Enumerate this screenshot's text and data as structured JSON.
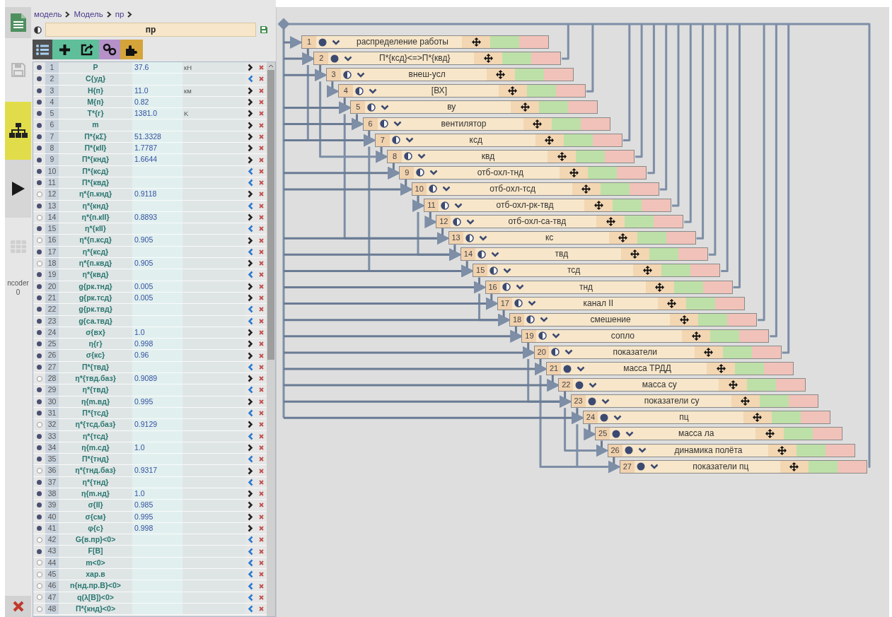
{
  "sidebar": {
    "items": [
      {
        "kind": "document",
        "selected": false
      },
      {
        "kind": "save",
        "selected": false
      },
      {
        "kind": "diagram",
        "selected": true
      },
      {
        "kind": "run",
        "selected": false
      },
      {
        "kind": "table",
        "selected": false
      }
    ],
    "label": "ncoder",
    "count": "0"
  },
  "breadcrumb": [
    {
      "label": "модель"
    },
    {
      "label": "Модель"
    },
    {
      "label": "пр"
    }
  ],
  "title_field": {
    "value": "пр"
  },
  "rows": [
    {
      "n": "1",
      "name": "P",
      "value": "37.6",
      "unit": "кН",
      "filled": true,
      "kind": "output"
    },
    {
      "n": "2",
      "name": "C{уд}",
      "filled": true,
      "kind": "input"
    },
    {
      "n": "3",
      "name": "H{п}",
      "value": "11.0",
      "unit": "км",
      "filled": true,
      "kind": "output"
    },
    {
      "n": "4",
      "name": "M{п}",
      "value": "0.82",
      "filled": true,
      "kind": "output"
    },
    {
      "n": "5",
      "name": "T*{г}",
      "value": "1381.0",
      "unit": "K",
      "filled": true,
      "kind": "output"
    },
    {
      "n": "6",
      "name": "m",
      "filled": true,
      "kind": "output"
    },
    {
      "n": "7",
      "name": "П*{кΣ}",
      "value": "51.3328",
      "filled": true,
      "kind": "output"
    },
    {
      "n": "8",
      "name": "П*{кII}",
      "value": "1.7787",
      "filled": true,
      "kind": "output"
    },
    {
      "n": "9",
      "name": "П*{кнд}",
      "value": "1.6644",
      "filled": true,
      "kind": "output"
    },
    {
      "n": "10",
      "name": "П*{ксд}",
      "filled": true,
      "kind": "input"
    },
    {
      "n": "11",
      "name": "П*{квд}",
      "filled": true,
      "kind": "input"
    },
    {
      "n": "12",
      "name": "η*{п.кнд}",
      "value": "0.9118",
      "filled": false,
      "kind": "output"
    },
    {
      "n": "13",
      "name": "η*{кнд}",
      "filled": true,
      "kind": "input"
    },
    {
      "n": "14",
      "name": "η*{п.кII}",
      "value": "0.8893",
      "filled": false,
      "kind": "output"
    },
    {
      "n": "15",
      "name": "η*{кII}",
      "filled": true,
      "kind": "input"
    },
    {
      "n": "16",
      "name": "η*{п.ксд}",
      "value": "0.905",
      "filled": false,
      "kind": "output"
    },
    {
      "n": "17",
      "name": "η*{ксд}",
      "filled": true,
      "kind": "input"
    },
    {
      "n": "18",
      "name": "η*{п.квд}",
      "value": "0.905",
      "filled": false,
      "kind": "output"
    },
    {
      "n": "19",
      "name": "η*{квд}",
      "filled": true,
      "kind": "input"
    },
    {
      "n": "20",
      "name": "g{рк.тнд}",
      "value": "0.005",
      "filled": true,
      "kind": "output"
    },
    {
      "n": "21",
      "name": "g{рк.тсд}",
      "value": "0.005",
      "filled": true,
      "kind": "output"
    },
    {
      "n": "22",
      "name": "g{рк.твд}",
      "filled": true,
      "kind": "input"
    },
    {
      "n": "23",
      "name": "g{са.твд}",
      "filled": true,
      "kind": "input"
    },
    {
      "n": "24",
      "name": "σ{вх}",
      "value": "1.0",
      "filled": true,
      "kind": "output"
    },
    {
      "n": "25",
      "name": "η{г}",
      "value": "0.998",
      "filled": true,
      "kind": "output"
    },
    {
      "n": "26",
      "name": "σ{кс}",
      "value": "0.96",
      "filled": true,
      "kind": "output"
    },
    {
      "n": "27",
      "name": "П*{твд}",
      "filled": true,
      "kind": "input"
    },
    {
      "n": "28",
      "name": "η*{твд.баз}",
      "value": "0.9089",
      "filled": false,
      "kind": "output"
    },
    {
      "n": "29",
      "name": "η*{твд}",
      "filled": true,
      "kind": "input"
    },
    {
      "n": "30",
      "name": "η{m.вд}",
      "value": "0.995",
      "filled": true,
      "kind": "output"
    },
    {
      "n": "31",
      "name": "П*{тсд}",
      "filled": true,
      "kind": "input"
    },
    {
      "n": "32",
      "name": "η*{тсд.баз}",
      "value": "0.9129",
      "filled": false,
      "kind": "output"
    },
    {
      "n": "33",
      "name": "η*{тсд}",
      "filled": true,
      "kind": "input"
    },
    {
      "n": "34",
      "name": "η{m.сд}",
      "value": "1.0",
      "filled": true,
      "kind": "output"
    },
    {
      "n": "35",
      "name": "П*{тнд}",
      "filled": true,
      "kind": "input"
    },
    {
      "n": "36",
      "name": "η*{тнд.баз}",
      "value": "0.9317",
      "filled": false,
      "kind": "output"
    },
    {
      "n": "37",
      "name": "η*{тнд}",
      "filled": true,
      "kind": "input"
    },
    {
      "n": "38",
      "name": "η{m.нд}",
      "value": "1.0",
      "filled": true,
      "kind": "output"
    },
    {
      "n": "39",
      "name": "σ{II}",
      "value": "0.985",
      "filled": true,
      "kind": "output"
    },
    {
      "n": "40",
      "name": "σ{см}",
      "value": "0.995",
      "filled": true,
      "kind": "output"
    },
    {
      "n": "41",
      "name": "φ{c}",
      "value": "0.998",
      "filled": true,
      "kind": "output"
    },
    {
      "n": "42",
      "name": "G{в.пр}<0>",
      "filled": false,
      "kind": "input"
    },
    {
      "n": "43",
      "name": "F[B]",
      "filled": true,
      "kind": "input"
    },
    {
      "n": "44",
      "name": "m<0>",
      "filled": false,
      "kind": "input"
    },
    {
      "n": "45",
      "name": "хар.в",
      "filled": false,
      "kind": "input"
    },
    {
      "n": "46",
      "name": "n{нд.пр.В}<0>",
      "filled": false,
      "kind": "input"
    },
    {
      "n": "47",
      "name": "q(λ[B])<0>",
      "filled": false,
      "kind": "input"
    },
    {
      "n": "48",
      "name": "П*{кнд}<0>",
      "filled": false,
      "kind": "input"
    }
  ],
  "nodes": [
    {
      "n": "1",
      "label": "распределение работы",
      "kind": "full"
    },
    {
      "n": "2",
      "label": "П*{ксд}<=>П*{квд}",
      "kind": "full"
    },
    {
      "n": "3",
      "label": "внеш-усл",
      "kind": "half"
    },
    {
      "n": "4",
      "label": "[ВХ]",
      "kind": "half"
    },
    {
      "n": "5",
      "label": "ву",
      "kind": "half"
    },
    {
      "n": "6",
      "label": "вентилятор",
      "kind": "half"
    },
    {
      "n": "7",
      "label": "ксд",
      "kind": "half"
    },
    {
      "n": "8",
      "label": "квд",
      "kind": "half"
    },
    {
      "n": "9",
      "label": "отб-охл-тнд",
      "kind": "half"
    },
    {
      "n": "10",
      "label": "отб-охл-тсд",
      "kind": "half"
    },
    {
      "n": "11",
      "label": "отб-охл-рк-твд",
      "kind": "half"
    },
    {
      "n": "12",
      "label": "отб-охл-са-твд",
      "kind": "half"
    },
    {
      "n": "13",
      "label": "кс",
      "kind": "half"
    },
    {
      "n": "14",
      "label": "твд",
      "kind": "half"
    },
    {
      "n": "15",
      "label": "тсд",
      "kind": "half"
    },
    {
      "n": "16",
      "label": "тнд",
      "kind": "half"
    },
    {
      "n": "17",
      "label": "канал II",
      "kind": "half"
    },
    {
      "n": "18",
      "label": "смешение",
      "kind": "half"
    },
    {
      "n": "19",
      "label": "сопло",
      "kind": "half"
    },
    {
      "n": "20",
      "label": "показатели",
      "kind": "half"
    },
    {
      "n": "21",
      "label": "масса ТРДД",
      "kind": "full"
    },
    {
      "n": "22",
      "label": "масса су",
      "kind": "full"
    },
    {
      "n": "23",
      "label": "показатели су",
      "kind": "full"
    },
    {
      "n": "24",
      "label": "пц",
      "kind": "full"
    },
    {
      "n": "25",
      "label": "масса ла",
      "kind": "full"
    },
    {
      "n": "26",
      "label": "динамика полёта",
      "kind": "full"
    },
    {
      "n": "27",
      "label": "показатели пц",
      "kind": "full"
    }
  ]
}
